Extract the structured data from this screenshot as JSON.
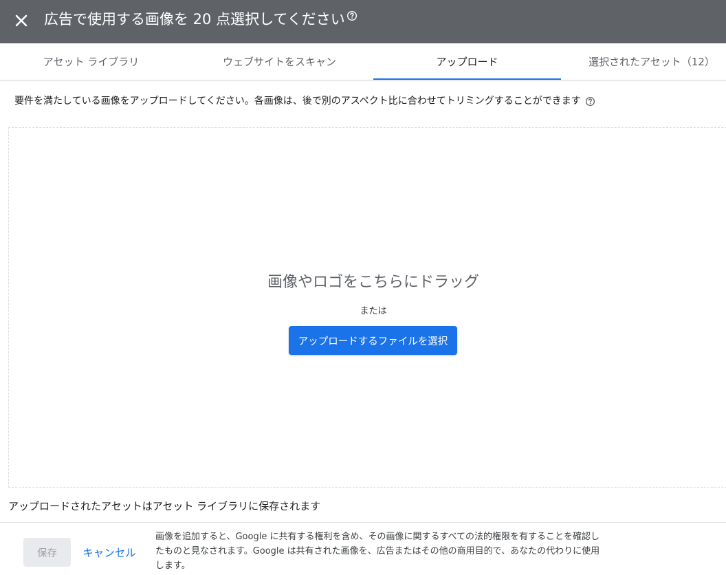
{
  "header": {
    "title": "広告で使用する画像を 20 点選択してください",
    "icons": {
      "close": "close-icon",
      "help": "help-icon"
    }
  },
  "tabs": [
    {
      "label": "アセット ライブラリ",
      "active": false
    },
    {
      "label": "ウェブサイトをスキャン",
      "active": false
    },
    {
      "label": "アップロード",
      "active": true
    },
    {
      "label": "選択されたアセット（12）",
      "active": false
    }
  ],
  "main": {
    "instructions": "要件を満たしている画像をアップロードしてください。各画像は、後で別のアスペクト比に合わせてトリミングすることができます",
    "dropzone": {
      "title": "画像やロゴをこちらにドラッグ",
      "or": "または",
      "upload_button": "アップロードするファイルを選択"
    },
    "saved_note": "アップロードされたアセットはアセット ライブラリに保存されます"
  },
  "footer": {
    "save_label": "保存",
    "cancel_label": "キャンセル",
    "legal_text": "画像を追加すると、Google に共有する権利を含め、その画像に関するすべての法的権限を有することを確認したものと見なされます。Google は共有された画像を、広告またはその他の商用目的で、あなたの代わりに使用します。"
  },
  "colors": {
    "header_bg": "#5f6368",
    "accent": "#1a73e8",
    "save_disabled_bg": "#e8eaed",
    "save_disabled_text": "#9aa0a6"
  }
}
